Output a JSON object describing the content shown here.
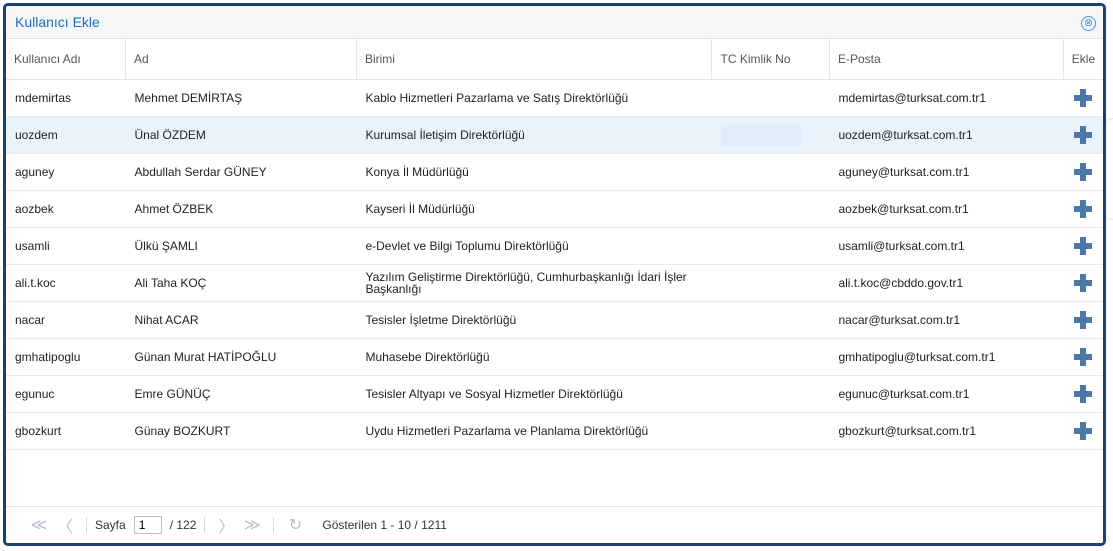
{
  "dialog": {
    "title": "Kullanıcı Ekle",
    "close_icon": "⊗"
  },
  "table": {
    "headers": [
      "Kullanıcı Adı",
      "Ad",
      "Birimi",
      "TC Kimlik No",
      "E-Posta",
      "Ekle"
    ],
    "rows": [
      {
        "username": "mdemirtas",
        "name": "Mehmet DEMİRTAŞ",
        "unit": "Kablo Hizmetleri Pazarlama ve Satış Direktörlüğü",
        "tc": "",
        "email": "mdemirtas@turksat.com.tr1"
      },
      {
        "username": "uozdem",
        "name": "Ünal ÖZDEM",
        "unit": "Kurumsal İletişim Direktörlüğü",
        "tc": "",
        "email": "uozdem@turksat.com.tr1"
      },
      {
        "username": "aguney",
        "name": "Abdullah Serdar GÜNEY",
        "unit": "Konya İl Müdürlüğü",
        "tc": "",
        "email": "aguney@turksat.com.tr1"
      },
      {
        "username": "aozbek",
        "name": "Ahmet ÖZBEK",
        "unit": "Kayseri İl Müdürlüğü",
        "tc": "",
        "email": "aozbek@turksat.com.tr1"
      },
      {
        "username": "usamli",
        "name": "Ülkü ŞAMLI",
        "unit": "e-Devlet ve Bilgi Toplumu Direktörlüğü",
        "tc": "",
        "email": "usamli@turksat.com.tr1"
      },
      {
        "username": "ali.t.koc",
        "name": "Ali Taha KOÇ",
        "unit": "Yazılım Geliştirme Direktörlüğü, Cumhurbaşkanlığı İdari İşler Başkanlığı",
        "tc": "",
        "email": "ali.t.koc@cbddo.gov.tr1"
      },
      {
        "username": "nacar",
        "name": "Nihat ACAR",
        "unit": "Tesisler İşletme Direktörlüğü",
        "tc": "",
        "email": "nacar@turksat.com.tr1"
      },
      {
        "username": "gmhatipoglu",
        "name": "Günan Murat HATİPOĞLU",
        "unit": "Muhasebe Direktörlüğü",
        "tc": "",
        "email": "gmhatipoglu@turksat.com.tr1"
      },
      {
        "username": "egunuc",
        "name": "Emre GÜNÜÇ",
        "unit": "Tesisler Altyapı ve Sosyal Hizmetler Direktörlüğü",
        "tc": "",
        "email": "egunuc@turksat.com.tr1"
      },
      {
        "username": "gbozkurt",
        "name": "Günay BOZKURT",
        "unit": "Uydu Hizmetleri Pazarlama ve Planlama Direktörlüğü",
        "tc": "",
        "email": "gbozkurt@turksat.com.tr1"
      }
    ],
    "selected_row": 1
  },
  "pager": {
    "first_icon": "≪",
    "prev_icon": "〈",
    "next_icon": "〉",
    "last_icon": "≫",
    "refresh_icon": "↻",
    "page_label": "Sayfa",
    "current_page": "1",
    "total_pages": "/ 122",
    "summary": "Gösterilen 1 - 10 / 1211"
  },
  "colors": {
    "border": "#1a3f72",
    "title": "#1f6fb8",
    "selected_row": "#e9f3fc",
    "plus": "#4d79aa"
  }
}
